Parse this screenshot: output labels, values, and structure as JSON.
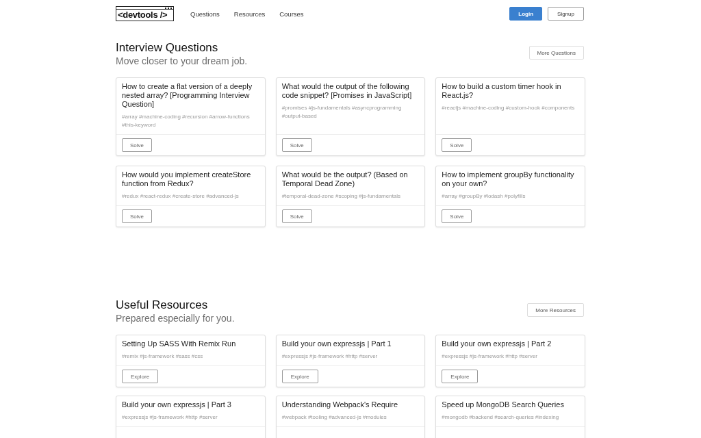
{
  "header": {
    "logo": "<devtools />",
    "nav": [
      "Questions",
      "Resources",
      "Courses"
    ],
    "buttons": [
      {
        "label": "Login",
        "kind": "primary"
      },
      {
        "label": "Signup",
        "kind": "outline"
      }
    ]
  },
  "sections": [
    {
      "title": "Interview Questions",
      "subtitle": "Move closer to your dream job.",
      "more_button": "More Questions",
      "cards": [
        {
          "title": "How to create a flat version of a deeply nested array? [Programming Interview Question]",
          "tags": "#array #machine-coding #recursion #arrow-functions #this-keyword",
          "button": "Solve"
        },
        {
          "title": "What would the output of the following code snippet? [Promises in JavaScript]",
          "tags": "#promises #js-fundamentals #asyncprogramming #output-based",
          "button": "Solve"
        },
        {
          "title": "How to build a custom timer hook in React.js?",
          "tags": "#reactjs #machine-coding #custom-hook #components",
          "button": "Solve"
        },
        {
          "title": "How would you implement createStore function from Redux?",
          "tags": "#redux #react-redux #create-store #advanced-js",
          "button": "Solve"
        },
        {
          "title": "What would be the output? (Based on Temporal Dead Zone)",
          "tags": "#temporal-dead-zone #scoping #js-fundamentals",
          "button": "Solve"
        },
        {
          "title": "How to implement groupBy functionality on your own?",
          "tags": "#array #groupBy #lodash #polyfills",
          "button": "Solve"
        }
      ]
    },
    {
      "title": "Useful Resources",
      "subtitle": "Prepared especially for you.",
      "more_button": "More Resources",
      "cards": [
        {
          "title": "Setting Up SASS With Remix Run",
          "tags": "#remix #js-framework #sass #css",
          "button": "Explore"
        },
        {
          "title": "Build your own expressjs | Part 1",
          "tags": "#expressjs #js-framework #http #server",
          "button": "Explore"
        },
        {
          "title": "Build your own expressjs | Part 2",
          "tags": "#expressjs #js-framework #http #server",
          "button": "Explore"
        },
        {
          "title": "Build your own expressjs | Part 3",
          "tags": "#expressjs #js-framework #http #server"
        },
        {
          "title": "Understanding Webpack's Require",
          "tags": "#webpack #tooling #advanced-js #modules"
        },
        {
          "title": "Speed up MongoDB Search Queries",
          "tags": "#mongodb #backend #search-queries #indexing"
        }
      ]
    }
  ]
}
